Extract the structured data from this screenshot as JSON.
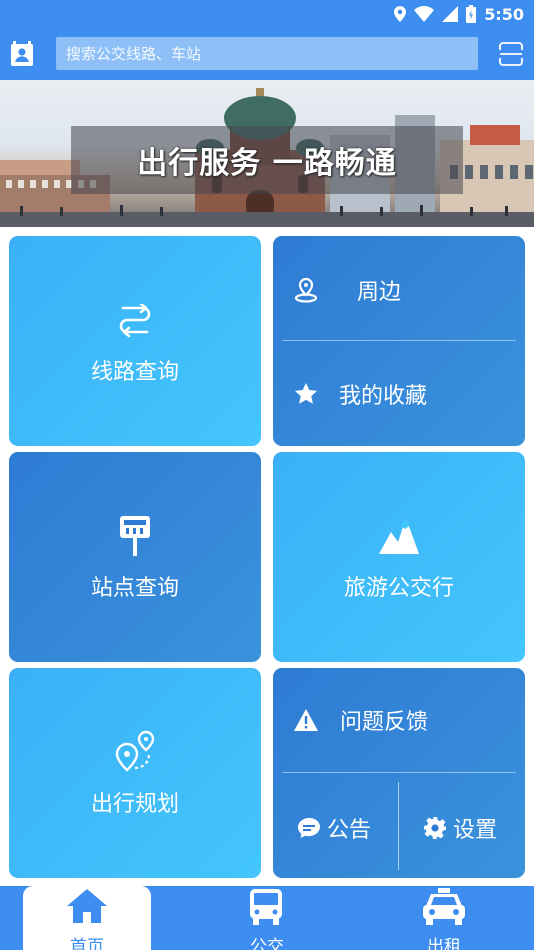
{
  "status_bar": {
    "time": "5:50",
    "icons": [
      "location-icon",
      "wifi-icon",
      "signal-icon",
      "battery-icon"
    ]
  },
  "header": {
    "search_placeholder": "搜索公交线路、车站",
    "left_icon": "contacts-icon",
    "right_icon": "scan-icon"
  },
  "banner": {
    "slogan": "出行服务 一路畅通"
  },
  "tiles": {
    "route_query": "线路查询",
    "nearby": "周边",
    "favorites": "我的收藏",
    "station_query": "站点查询",
    "tourism": "旅游公交行",
    "trip_plan": "出行规划",
    "feedback": "问题反馈",
    "notice": "公告",
    "settings": "设置"
  },
  "tabbar": {
    "items": [
      {
        "label": "首页",
        "icon": "home-icon",
        "active": true
      },
      {
        "label": "公交",
        "icon": "bus-icon",
        "active": false
      },
      {
        "label": "出租",
        "icon": "taxi-icon",
        "active": false
      }
    ]
  },
  "colors": {
    "primary": "#3d8ef0",
    "tile_light": "#3bb0f7",
    "tile_dark": "#2f7bd4"
  }
}
